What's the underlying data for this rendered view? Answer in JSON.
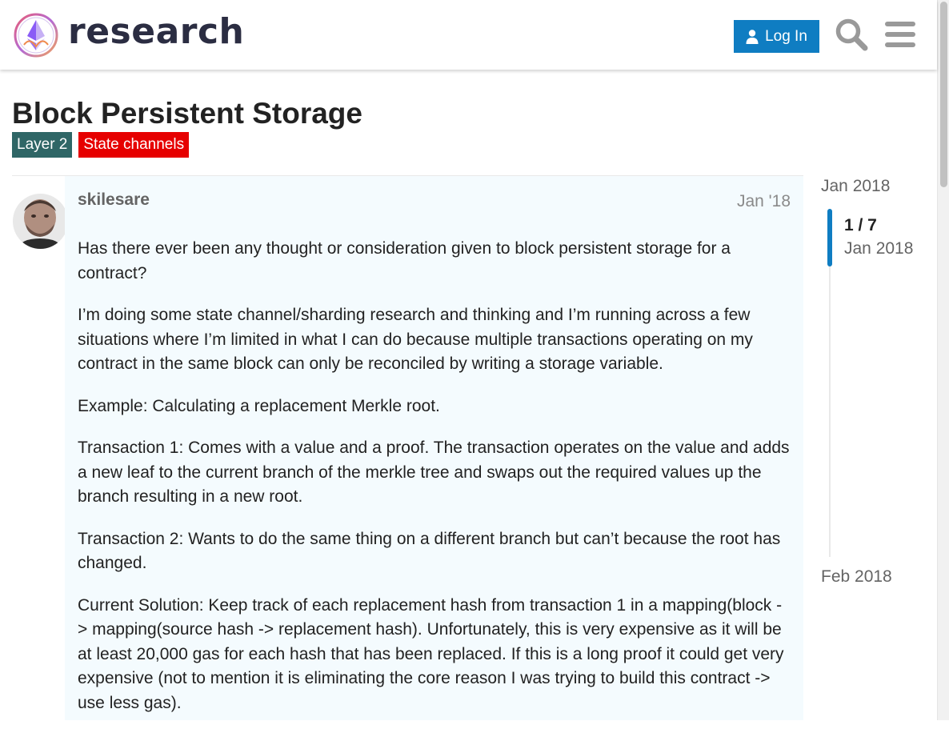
{
  "header": {
    "site_name": "research",
    "login_label": "Log In",
    "accent_color": "#0f7dc2",
    "icons": {
      "logo": "ethereum-research-logo",
      "login": "user-icon",
      "search": "search-icon",
      "menu": "hamburger-menu-icon"
    }
  },
  "topic": {
    "title": "Block Persistent Storage",
    "tags": [
      {
        "label": "Layer 2",
        "color": "#2f6666"
      },
      {
        "label": "State channels",
        "color": "#e60000"
      }
    ]
  },
  "post": {
    "username": "skilesare",
    "date": "Jan '18",
    "paragraphs": [
      "Has there ever been any thought or consideration given to block persistent storage for a contract?",
      "I’m doing some state channel/sharding research and thinking and I’m running across a few situations where I’m limited in what I can do because multiple transactions operating on my contract in the same block can only be reconciled by writing a storage variable.",
      "Example: Calculating a replacement Merkle root.",
      "Transaction 1: Comes with a value and a proof. The transaction operates on the value and adds a new leaf to the current branch of the merkle tree and swaps out the required values up the branch resulting in a new root.",
      "Transaction 2: Wants to do the same thing on a different branch but can’t because the root has changed.",
      "Current Solution: Keep track of each replacement hash from transaction 1 in a mapping(block -> mapping(source hash -> replacement hash). Unfortunately, this is very expensive as it will be at least 20,000 gas for each hash that has been replaced. If this is a long proof it could get very expensive (not to mention it is eliminating the core reason I was trying to build this contract -> use less gas)."
    ]
  },
  "timeline": {
    "start_date": "Jan 2018",
    "counter": "1 / 7",
    "counter_date": "Jan 2018",
    "end_date": "Feb 2018"
  }
}
